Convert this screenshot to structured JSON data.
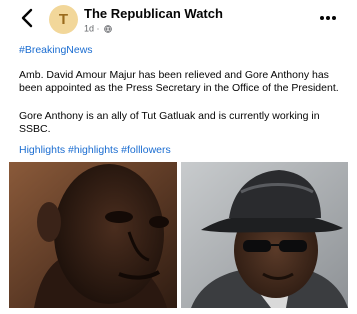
{
  "header": {
    "avatar_letter": "T",
    "page_name": "The Republican Watch",
    "time": "1d",
    "separator": "·",
    "icons": {
      "back": "back-arrow-icon",
      "audience": "globe-icon",
      "more": "more-dots-icon"
    }
  },
  "post": {
    "hashtag": "#BreakingNews",
    "paragraph_1": "Amb. David Amour Majur has been relieved and Gore Anthony has been appointed as the Press Secretary in the Office of the President.",
    "paragraph_2": "Gore Anthony is an ally of Tut Gatluak and is currently working in SSBC.",
    "tags": "Highlights #highlights #folllowers"
  },
  "colors": {
    "link": "#1b6dd1",
    "text": "#050505",
    "secondary_text": "#65676b",
    "avatar_bg": "#f2d79a",
    "avatar_text": "#9a6b1d"
  }
}
